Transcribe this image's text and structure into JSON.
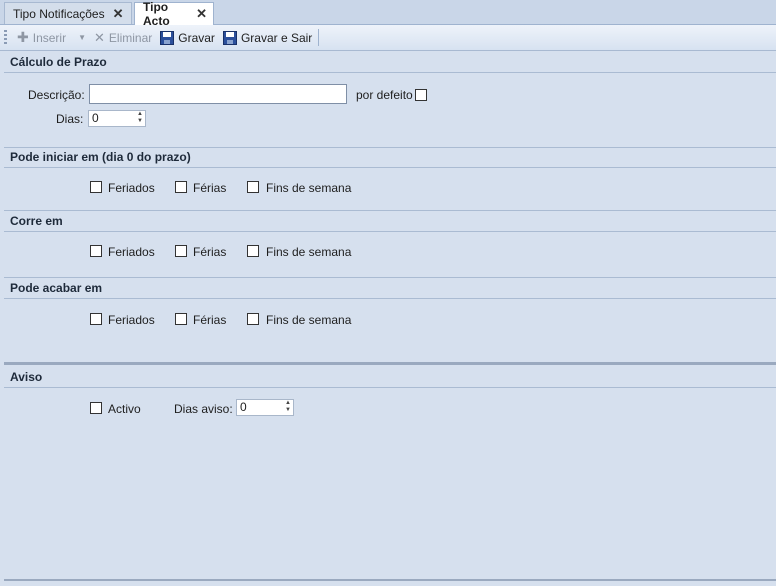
{
  "tabs": [
    {
      "label": "Tipo Notificações",
      "active": false
    },
    {
      "label": "Tipo Acto",
      "active": true
    }
  ],
  "toolbar": {
    "inserir": "Inserir",
    "eliminar": "Eliminar",
    "gravar": "Gravar",
    "gravar_sair": "Gravar e Sair"
  },
  "calculo": {
    "title": "Cálculo de Prazo",
    "descricao_label": "Descrição:",
    "descricao_value": "",
    "por_defeito_label": "por defeito",
    "dias_label": "Dias:",
    "dias_value": "0"
  },
  "sections": [
    {
      "title": "Pode iniciar em (dia 0 do prazo)",
      "feriados": "Feriados",
      "ferias": "Férias",
      "fins": "Fins de semana"
    },
    {
      "title": "Corre em",
      "feriados": "Feriados",
      "ferias": "Férias",
      "fins": "Fins de semana"
    },
    {
      "title": "Pode acabar em",
      "feriados": "Feriados",
      "ferias": "Férias",
      "fins": "Fins de semana"
    }
  ],
  "aviso": {
    "title": "Aviso",
    "activo_label": "Activo",
    "dias_aviso_label": "Dias aviso:",
    "dias_aviso_value": "0"
  },
  "colors": {
    "background": "#d6e0ee",
    "accent": "#2f4f8f"
  }
}
